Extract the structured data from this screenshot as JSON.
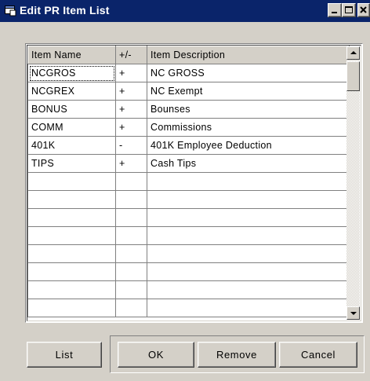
{
  "window": {
    "title": "Edit PR Item List"
  },
  "grid": {
    "columns": [
      "Item Name",
      "+/-",
      "Item Description"
    ],
    "rows": [
      {
        "name": "NCGROS",
        "sign": "+",
        "description": "NC GROSS"
      },
      {
        "name": "NCGREX",
        "sign": "+",
        "description": "NC Exempt"
      },
      {
        "name": "BONUS",
        "sign": "+",
        "description": "Bounses"
      },
      {
        "name": "COMM",
        "sign": "+",
        "description": "Commissions"
      },
      {
        "name": "401K",
        "sign": "-",
        "description": "401K Employee Deduction"
      },
      {
        "name": "TIPS",
        "sign": "+",
        "description": "Cash Tips"
      },
      {
        "name": "",
        "sign": "",
        "description": ""
      },
      {
        "name": "",
        "sign": "",
        "description": ""
      },
      {
        "name": "",
        "sign": "",
        "description": ""
      },
      {
        "name": "",
        "sign": "",
        "description": ""
      },
      {
        "name": "",
        "sign": "",
        "description": ""
      },
      {
        "name": "",
        "sign": "",
        "description": ""
      },
      {
        "name": "",
        "sign": "",
        "description": ""
      },
      {
        "name": "",
        "sign": "",
        "description": ""
      }
    ]
  },
  "buttons": {
    "list": "List",
    "ok": "OK",
    "remove": "Remove",
    "cancel": "Cancel"
  },
  "colors": {
    "titlebar": "#0a246a",
    "face": "#d4d0c8"
  }
}
